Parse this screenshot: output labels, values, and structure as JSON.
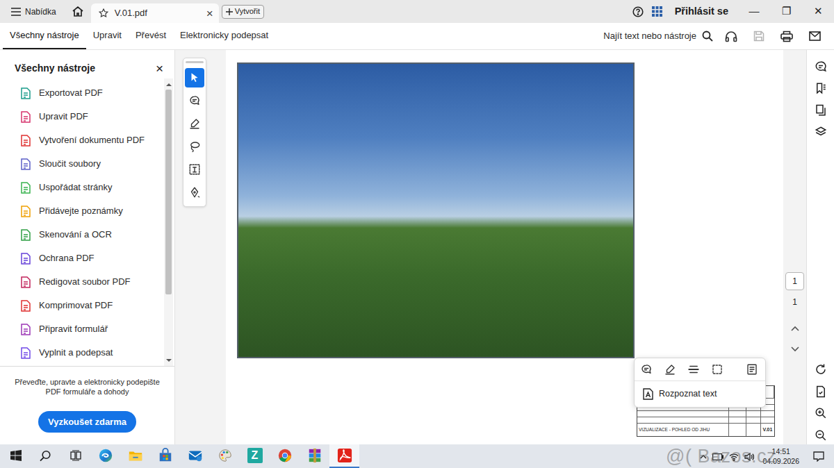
{
  "titlebar": {
    "menu": "Nabídka",
    "tab": {
      "title": "V.01.pdf",
      "close": "×",
      "selected": true
    },
    "new_button": "Vytvořit",
    "sign_in": "Přihlásit se",
    "window_controls": [
      "—",
      "❐",
      "✕"
    ]
  },
  "toolbar": {
    "tabs": [
      {
        "label": "Všechny nástroje",
        "selected": true
      },
      {
        "label": "Upravit",
        "selected": false
      },
      {
        "label": "Převést",
        "selected": false
      },
      {
        "label": "Elektronicky podepsat",
        "selected": false
      }
    ],
    "search": "Najít text nebo nástroje",
    "save_disabled": true
  },
  "tools_panel": {
    "title": "Všechny nástroje",
    "close": "×",
    "items": [
      {
        "label": "Exportovat PDF",
        "color": "#1a9c8a"
      },
      {
        "label": "Upravit PDF",
        "color": "#d6336c"
      },
      {
        "label": "Vytvoření dokumentu PDF",
        "color": "#e03131"
      },
      {
        "label": "Sloučit soubory",
        "color": "#5b5fc7"
      },
      {
        "label": "Uspořádat stránky",
        "color": "#37b24d"
      },
      {
        "label": "Přidávejte poznámky",
        "color": "#f0a000"
      },
      {
        "label": "Skenování a OCR",
        "color": "#2f9e44"
      },
      {
        "label": "Ochrana PDF",
        "color": "#6741d9"
      },
      {
        "label": "Redigovat soubor PDF",
        "color": "#c2255c"
      },
      {
        "label": "Komprimovat PDF",
        "color": "#e03131"
      },
      {
        "label": "Připravit formulář",
        "color": "#9c36b5"
      },
      {
        "label": "Vyplnit a podepsat",
        "color": "#7048e8"
      }
    ],
    "promo": "Převeďte, upravte a elektronicky podepište PDF formuláře a dohody",
    "button": "Vyzkoušet zdarma"
  },
  "quick_tools": [
    {
      "kind": "select",
      "selected": true
    },
    {
      "kind": "comment",
      "selected": false
    },
    {
      "kind": "pen",
      "selected": false
    },
    {
      "kind": "lasso",
      "selected": false
    },
    {
      "kind": "textselect",
      "selected": false
    },
    {
      "kind": "sign",
      "selected": false
    }
  ],
  "document": {
    "title_block": {
      "title": "VIZUALIZACE - POHLED OD JIHU",
      "sheet": "V.01"
    }
  },
  "context_menu": {
    "tools": [
      {
        "kind": "comment"
      },
      {
        "kind": "pen"
      },
      {
        "kind": "strike"
      },
      {
        "kind": "marquee"
      },
      {
        "kind": "form"
      }
    ],
    "item": "Rozpoznat text"
  },
  "page_nav": {
    "current": "1",
    "total": "1"
  },
  "taskbar": {
    "apps": [
      {
        "kind": "start",
        "selected": false
      },
      {
        "kind": "search",
        "selected": false
      },
      {
        "kind": "taskview",
        "selected": false
      },
      {
        "kind": "edge",
        "selected": false
      },
      {
        "kind": "explorer",
        "selected": false
      },
      {
        "kind": "store",
        "selected": false
      },
      {
        "kind": "mail",
        "selected": false
      },
      {
        "kind": "paint",
        "selected": false
      },
      {
        "kind": "zoner",
        "label": "Z",
        "selected": false
      },
      {
        "kind": "chrome",
        "selected": false
      },
      {
        "kind": "winrar",
        "selected": false
      },
      {
        "kind": "acrobat",
        "selected": true
      }
    ],
    "time": "14:51",
    "date": "04.09.2026"
  },
  "watermark": "@( Bazos.cz"
}
